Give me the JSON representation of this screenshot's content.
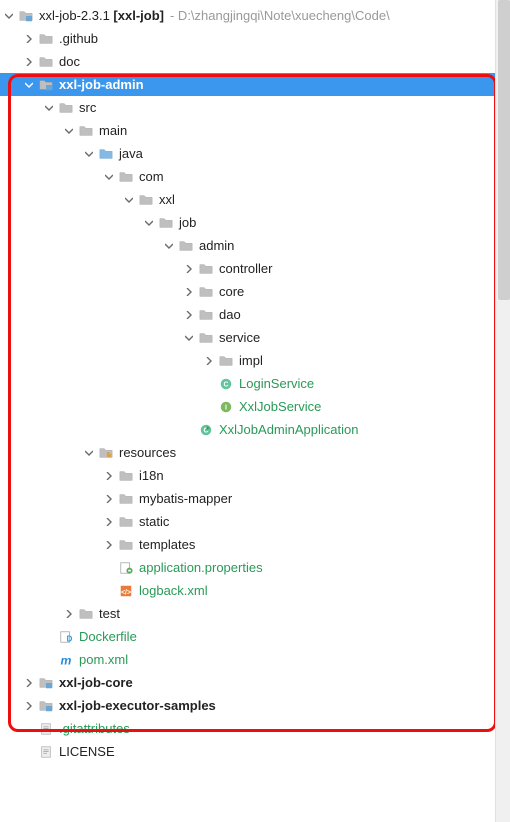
{
  "root": {
    "label_a": "xxl-job-2.3.1 ",
    "label_b": "[xxl-job]",
    "path": "- D:\\zhangjingqi\\Note\\xuecheng\\Code\\"
  },
  "n_github": ".github",
  "n_doc": "doc",
  "n_admin": "xxl-job-admin",
  "n_src": "src",
  "n_main": "main",
  "n_java": "java",
  "n_com": "com",
  "n_xxl": "xxl",
  "n_job": "job",
  "n_admin2": "admin",
  "n_controller": "controller",
  "n_core": "core",
  "n_dao": "dao",
  "n_service": "service",
  "n_impl": "impl",
  "n_loginsvc": "LoginService",
  "n_xxljobsvc": "XxlJobService",
  "n_app": "XxlJobAdminApplication",
  "n_resources": "resources",
  "n_i18n": "i18n",
  "n_mybatis": "mybatis-mapper",
  "n_static": "static",
  "n_templates": "templates",
  "n_appprops": "application.properties",
  "n_logback": "logback.xml",
  "n_test": "test",
  "n_dockerfile": "Dockerfile",
  "n_pom": "pom.xml",
  "n_jobcore": "xxl-job-core",
  "n_executor": "xxl-job-executor-samples",
  "n_gitattr": ".gitattributes",
  "n_license": "LICENSE"
}
